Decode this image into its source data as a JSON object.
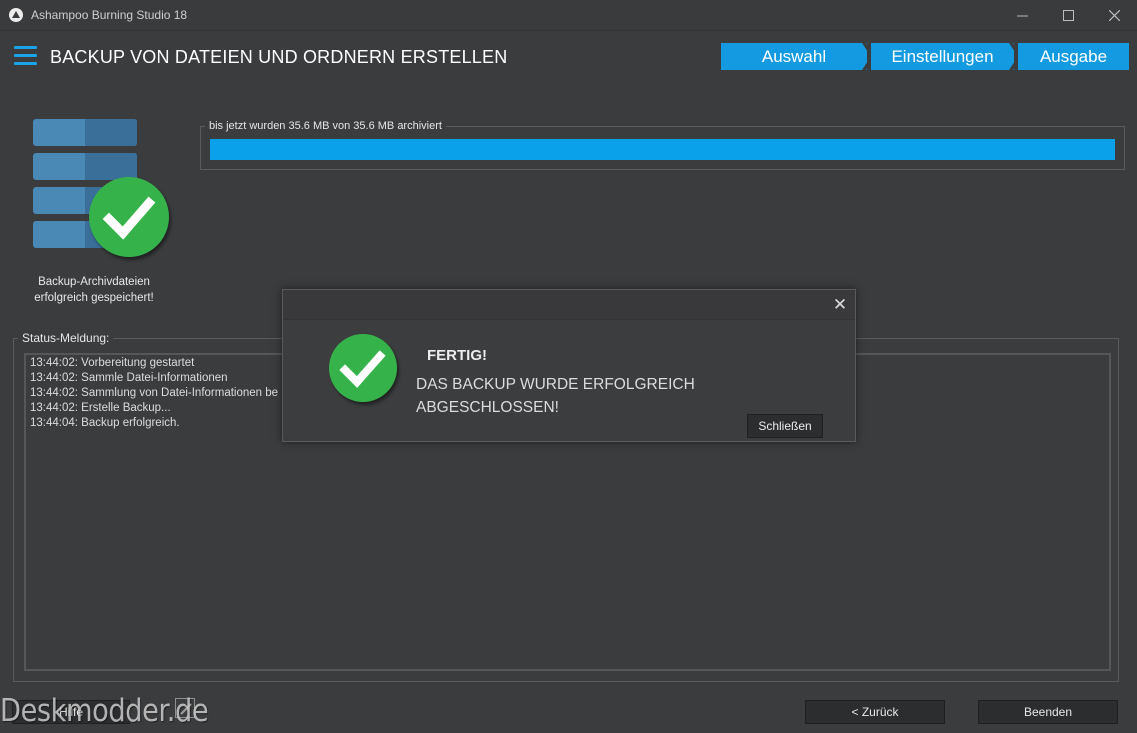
{
  "window": {
    "title": "Ashampoo Burning Studio 18",
    "minimize": "—",
    "maximize": "☐",
    "close": "✕"
  },
  "header": {
    "title": "BACKUP VON DATEIEN UND ORDNERN ERSTELLEN",
    "steps": [
      "Auswahl",
      "Einstellungen",
      "Ausgabe"
    ]
  },
  "result": {
    "caption_line1": "Backup-Archivdateien",
    "caption_line2": "erfolgreich gespeichert!"
  },
  "progress": {
    "label": "bis jetzt wurden  35.6 MB von  35.6 MB archiviert",
    "fraction": 1.0,
    "color": "#0aa0ea"
  },
  "status": {
    "legend": "Status-Meldung:",
    "lines": [
      "13:44:02: Vorbereitung gestartet",
      "13:44:02: Sammle Datei-Informationen",
      "13:44:02: Sammlung von Datei-Informationen be",
      "13:44:02: Erstelle Backup...",
      "13:44:04: Backup erfolgreich."
    ]
  },
  "footer": {
    "help": "Hilfe",
    "back": "< Zurück",
    "quit": "Beenden",
    "watermark": "Deskmodder.de"
  },
  "dialog": {
    "close": "✕",
    "heading": "FERTIG!",
    "message_line1": "DAS BACKUP WURDE ERFOLGREICH",
    "message_line2": "ABGESCHLOSSEN!",
    "button": "Schließen",
    "icon": "check-circle-icon"
  },
  "colors": {
    "accent": "#139ae0",
    "success": "#35b34a",
    "background": "#3b3c3e"
  }
}
